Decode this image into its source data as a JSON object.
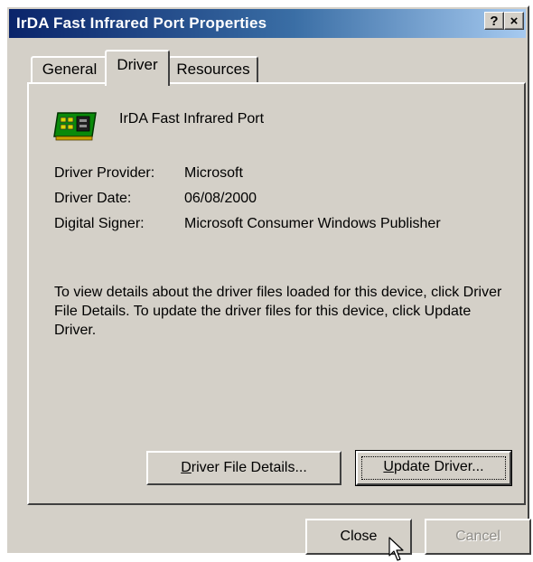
{
  "window": {
    "title": "IrDA Fast Infrared Port Properties",
    "help_button": "?",
    "close_button": "×"
  },
  "tabs": [
    {
      "label": "General",
      "active": false
    },
    {
      "label": "Driver",
      "active": true
    },
    {
      "label": "Resources",
      "active": false
    }
  ],
  "device": {
    "icon": "infrared-port-card-icon",
    "name": "IrDA Fast Infrared Port"
  },
  "driver_info": {
    "provider_label": "Driver Provider:",
    "provider_value": "Microsoft",
    "date_label": "Driver Date:",
    "date_value": "06/08/2000",
    "signer_label": "Digital Signer:",
    "signer_value": "Microsoft Consumer Windows Publisher"
  },
  "description": "To view details about the driver files loaded for this device, click Driver File Details.  To update the driver files for this device, click Update Driver.",
  "buttons": {
    "file_details_mnemonic": "D",
    "file_details_rest": "river File Details...",
    "update_driver_mnemonic": "U",
    "update_driver_rest": "pdate Driver...",
    "close": "Close",
    "cancel": "Cancel"
  },
  "colors": {
    "title_gradient_start": "#0a246a",
    "title_gradient_end": "#a6caf0",
    "face": "#d4d0c8",
    "disabled_text": "#8f8d88"
  }
}
